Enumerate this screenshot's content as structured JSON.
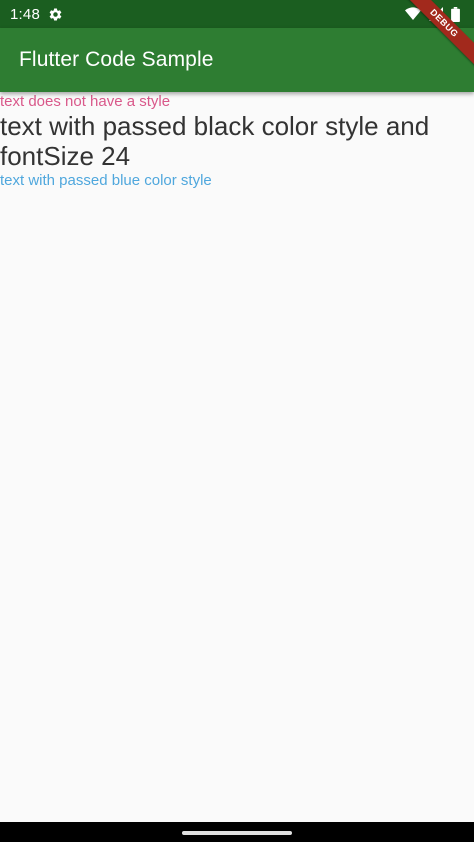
{
  "status_bar": {
    "time": "1:48",
    "icons": [
      "gear-icon",
      "wifi-icon",
      "signal-icon",
      "battery-icon"
    ],
    "color": "#1b5e20"
  },
  "app_bar": {
    "title": "Flutter Code Sample",
    "color": "#2e7d32"
  },
  "debug_banner": {
    "label": "DEBUG",
    "color": "#a2291c"
  },
  "content": {
    "text_default": {
      "text": "text does not have a style",
      "color": "#d9588a"
    },
    "text_black": {
      "text": "text with passed black color style and fontSize 24",
      "color": "#333333"
    },
    "text_blue": {
      "text": "text with passed blue color style",
      "color": "#4fa7dd"
    }
  },
  "nav_bar": {
    "icons": [
      "home-handle-icon"
    ]
  }
}
